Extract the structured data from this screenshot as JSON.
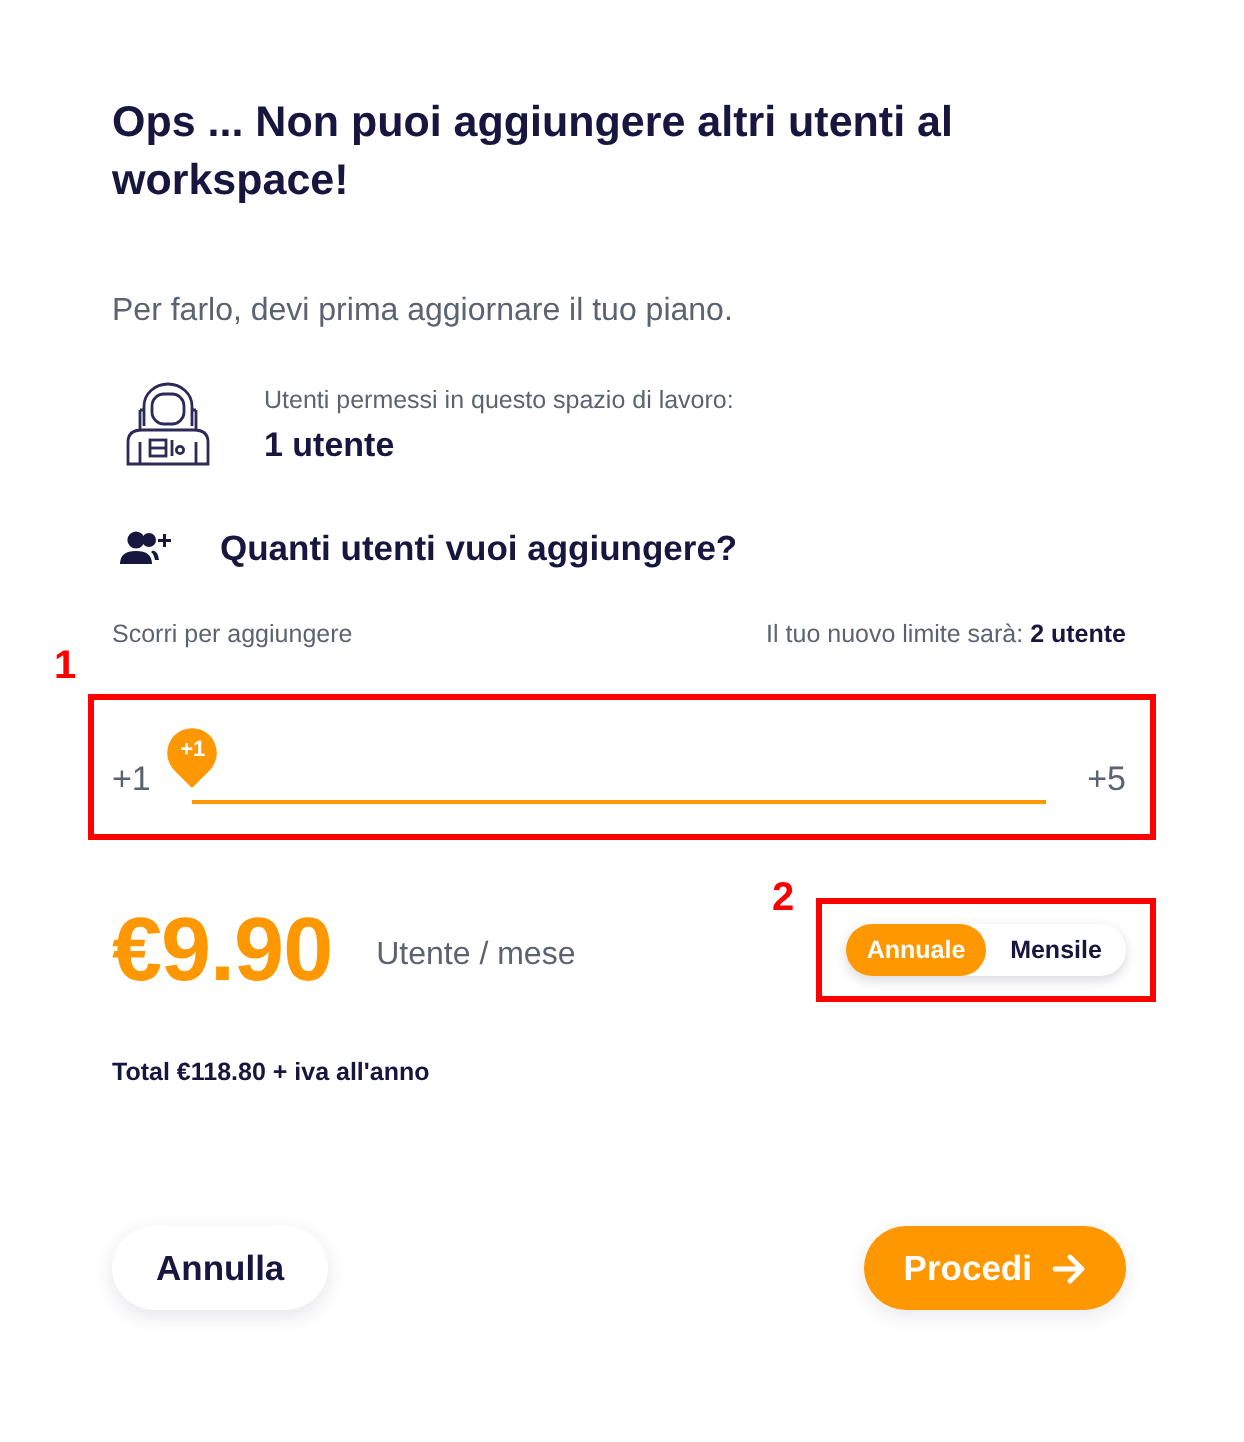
{
  "dialog": {
    "title": "Ops ... Non puoi aggiungere altri utenti al workspace!",
    "subtitle": "Per farlo, devi prima aggiornare il tuo piano."
  },
  "current_plan": {
    "caption": "Utenti permessi in questo spazio di lavoro:",
    "value": "1 utente"
  },
  "add_users": {
    "heading": "Quanti utenti vuoi aggiungere?",
    "hint": "Scorri per aggiungere",
    "new_limit": "Il tuo nuovo limite sarà: **2 utente**"
  },
  "slider": {
    "min_label": "+1",
    "max_label": "+5",
    "value_label": "+1",
    "level": 0
  },
  "pricing": {
    "price": "€9.90",
    "unit": "Utente / mese",
    "billing": [
      {
        "label": "Annuale",
        "selected": true
      },
      {
        "label": "Mensile",
        "selected": false
      }
    ],
    "total": "Total €118.80 + iva all'anno"
  },
  "buttons": [
    {
      "label": "Annulla",
      "kind": "secondary"
    },
    {
      "label": "Procedi",
      "kind": "primary"
    }
  ],
  "annotations": [
    {
      "label": "1"
    },
    {
      "label": "2"
    }
  ]
}
